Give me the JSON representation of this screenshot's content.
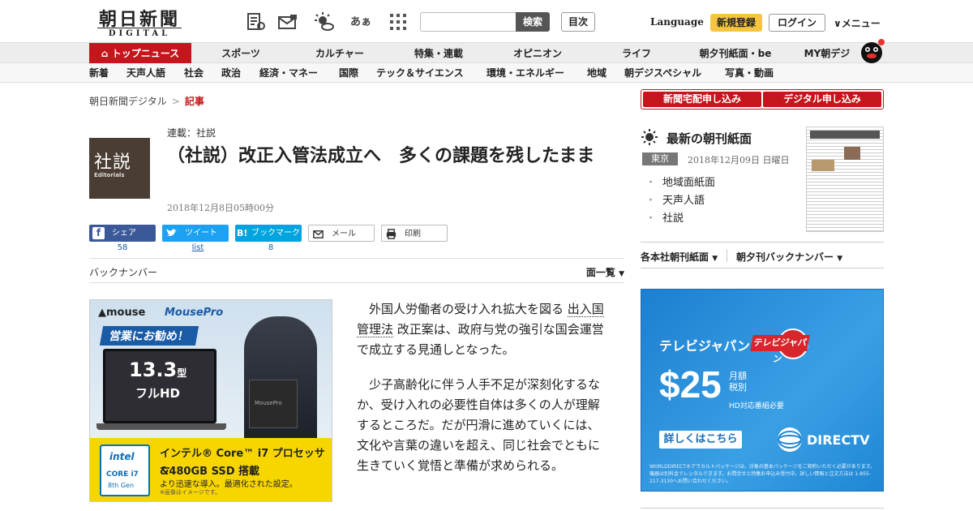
{
  "header": {
    "logo_kanji": "朝日新聞",
    "logo_sub": "DIGITAL",
    "search_placeholder": "",
    "search_label": "検索",
    "index_label": "目次",
    "language_label": "Language",
    "register_label": "新規登録",
    "login_label": "ログイン",
    "menu_label": "メニュー",
    "icons": [
      "paper-icon",
      "mail-icon",
      "weather-icon",
      "font-size-icon",
      "grid-icon"
    ],
    "font_icon_text": "あぁ"
  },
  "nav_main": {
    "items": [
      {
        "label": "トップニュース",
        "active": true
      },
      {
        "label": "スポーツ"
      },
      {
        "label": "カルチャー"
      },
      {
        "label": "特集・連載"
      },
      {
        "label": "オピニオン"
      },
      {
        "label": "ライフ"
      },
      {
        "label": "朝夕刊紙面・be"
      },
      {
        "label": "MY朝デジ"
      }
    ]
  },
  "nav_sub": {
    "items": [
      "新着",
      "天声人語",
      "社会",
      "政治",
      "経済・マネー",
      "国際",
      "テック＆サイエンス",
      "環境・エネルギー",
      "地域",
      "朝デジスペシャル",
      "写真・動画"
    ]
  },
  "breadcrumb": {
    "home": "朝日新聞デジタル",
    "separator": ">",
    "current": "記事"
  },
  "article": {
    "thumb_kanji": "社説",
    "thumb_en": "Editorials",
    "series": "連載：社説",
    "title": "（社説）改正入管法成立へ　多くの課題を残したまま",
    "date": "2018年12月8日05時00分",
    "share": {
      "facebook_label": "シェア",
      "facebook_count": "58",
      "twitter_label": "ツイート",
      "twitter_count": "list",
      "hatena_label": "ブックマーク",
      "hatena_icon_text": "B!",
      "hatena_count": "8",
      "mail_label": "メール",
      "print_label": "印刷"
    },
    "backnumber_label": "バックナンバー",
    "menpyo_label": "面一覧",
    "body": {
      "p1_pre": "外国人労働者の受け入れ拡大を図る",
      "p1_kw": "出入国管理法",
      "p1_post": "改正案は、政府与党の強引な国会運営で成立する見通しとなった。",
      "p2": "少子高齢化に伴う人手不足が深刻化するなか、受け入れの必要性自体は多くの人が理解するところだ。だが円滑に進めていくには、文化や言葉の違いを超え、同じ社会でともに生きていく覚悟と準備が求められる。"
    }
  },
  "ad_left": {
    "brand1": "▲mouse",
    "brand2": "MousePro",
    "promo": "営業にお勧め！",
    "size": "13.3",
    "size_unit": "型",
    "hd": "フルHD",
    "product_label": "MousePro",
    "intel_a": "intel",
    "intel_b": "CORE i7",
    "intel_c": "8th Gen",
    "spec1": "インテル® Core™ i7 プロセッサー",
    "spec2": "&480GB SSD 搭載",
    "spec3": "より迅速な導入。最適化された設定。",
    "spec4": "※画像はイメージです。"
  },
  "right": {
    "subscribe_paper": "新聞宅配申し込み",
    "subscribe_digital": "デジタル申し込み",
    "latest_title": "最新の朝刊紙面",
    "edition": "東京",
    "edition_date": "2018年12月09日 日曜日",
    "links": [
      "地域面紙面",
      "天声人語",
      "社説"
    ],
    "regional_paper": "各本社朝刊紙面",
    "evening_backnumber": "朝夕刊バックナンバー"
  },
  "ad_right": {
    "brand": "テレビジャパン",
    "logo_text": "テレビジャパン",
    "price": "$25",
    "monthly": "月額",
    "tax": "税別",
    "hd_note": "HD対応番組必要",
    "cta": "詳しくはこちら",
    "dtv": "DIRECTV",
    "fine": "WORLDDIRECT®アラカルトパッケージは、対象の基本パッケージをご契約いただく必要があります。機器は別料金でレンタルできます。お問合せと特集お申込み受付中。詳しい情報と注文方法は 1-855-217-3130へお問い合わせください。"
  }
}
